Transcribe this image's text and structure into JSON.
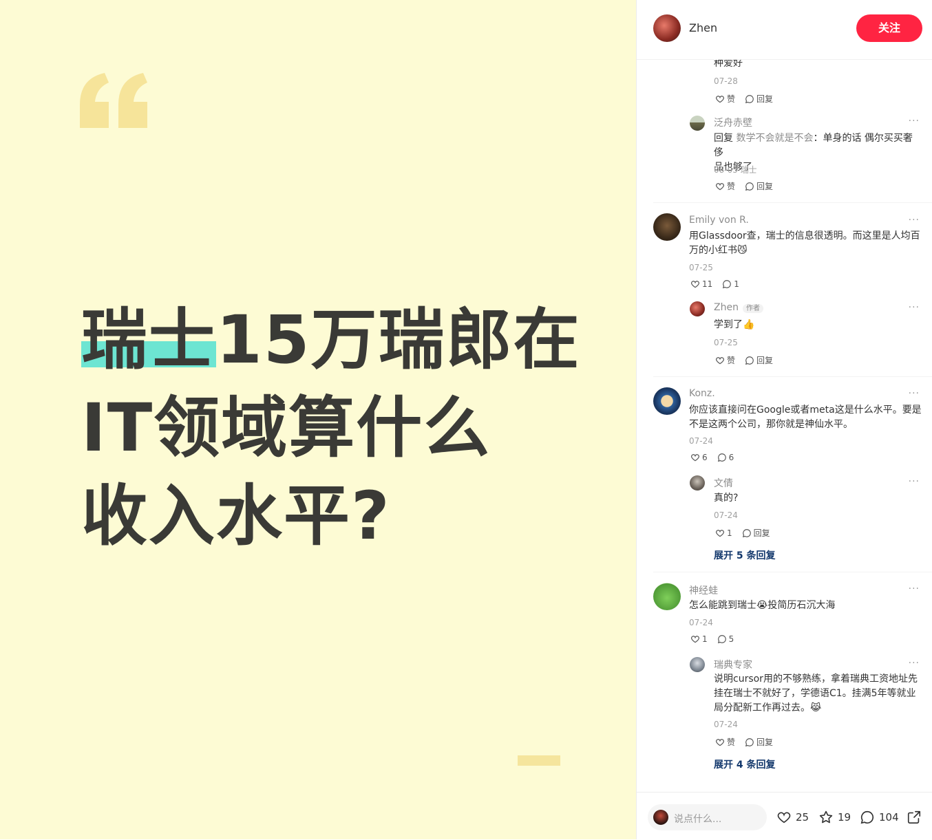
{
  "image": {
    "title_lines": [
      "瑞士15万瑞郎在",
      "IT领域算什么",
      "收入水平?"
    ],
    "highlight": "瑞士",
    "title_line1_rest": "15万瑞郎在"
  },
  "header": {
    "author": "Zhen",
    "follow_label": "关注"
  },
  "comments": {
    "top_fragment": {
      "text": "种爱好",
      "date": "07-28",
      "like": "赞",
      "reply": "回复"
    },
    "r1": {
      "name": "泛舟赤壁",
      "reply_prefix": "回复",
      "reply_to": "数学不会就是不会",
      "text_line1": "：单身的话 偶尔买买奢侈",
      "text_line2": "品也够了",
      "date": "08-05 瑞士",
      "like": "赞",
      "reply": "回复"
    },
    "c1": {
      "name": "Emily von R.",
      "text_line1": "用Glassdoor查，瑞士的信息很透明。而这里是人均百",
      "text_line2": "万的小红书😼",
      "date": "07-25",
      "likes": "11",
      "replies": "1"
    },
    "c1r1": {
      "name": "Zhen",
      "badge": "作者",
      "text": "学到了👍",
      "date": "07-25",
      "like": "赞",
      "reply": "回复"
    },
    "c2": {
      "name": "Konz.",
      "text_line1": "你应该直接问在Google或者meta这是什么水平。要是",
      "text_line2": "不是这两个公司，那你就是神仙水平。",
      "date": "07-24",
      "likes": "6",
      "replies": "6"
    },
    "c2r1": {
      "name": "文倩",
      "text": "真的?",
      "date": "07-24",
      "likes": "1",
      "reply": "回复"
    },
    "c2_expand": "展开 5 条回复",
    "c3": {
      "name": "神经蛙",
      "text": "怎么能跳到瑞士😭投简历石沉大海",
      "date": "07-24",
      "likes": "1",
      "replies": "5"
    },
    "c3r1": {
      "name": "瑞典专家",
      "text_line1": "说明cursor用的不够熟练，拿着瑞典工资地址先",
      "text_line2": "挂在瑞士不就好了，学德语C1。挂满5年等就业",
      "text_line3": "局分配新工作再过去。😹",
      "date": "07-24",
      "like": "赞",
      "reply": "回复"
    },
    "c3_expand": "展开 4 条回复",
    "more": "···"
  },
  "bottom": {
    "placeholder": "说点什么...",
    "likes": "25",
    "stars": "19",
    "comments": "104"
  },
  "colors": {
    "bg": "#fdfbd4",
    "accent": "#ff2442",
    "highlight": "#6de5d2",
    "expand": "#13386c"
  }
}
